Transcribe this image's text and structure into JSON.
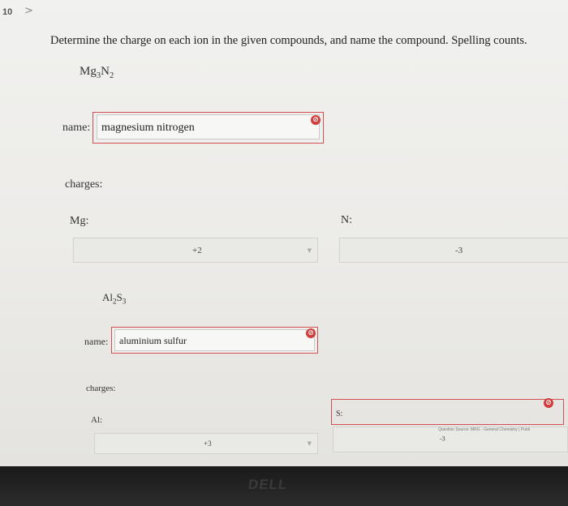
{
  "nav": {
    "question_number": "10",
    "next_glyph": ">"
  },
  "question": {
    "prompt": "Determine the charge on each ion in the given compounds, and name the compound. Spelling counts."
  },
  "compound1": {
    "formula_el1": "Mg",
    "formula_sub1": "3",
    "formula_el2": "N",
    "formula_sub2": "2",
    "name_label": "name:",
    "name_value": "magnesium nitrogen",
    "charges_label": "charges:",
    "cation_label": "Mg:",
    "cation_value": "+2",
    "anion_label": "N:",
    "anion_value": "-3",
    "status_icon": "incorrect-icon"
  },
  "compound2": {
    "formula_el1": "Al",
    "formula_sub1": "2",
    "formula_el2": "S",
    "formula_sub2": "3",
    "name_label": "name:",
    "name_value": "aluminium sulfur",
    "charges_label": "charges:",
    "cation_label": "Al:",
    "cation_value": "+3",
    "anion_label": "S:",
    "anion_value": "-3",
    "status_icon": "incorrect-icon"
  },
  "footer": {
    "source": "Question Source: MRG - General Chemistry | Publi"
  },
  "device": {
    "logo": "DELL"
  },
  "colors": {
    "error": "#d43c3c",
    "field_bg": "#e9e9e6"
  }
}
